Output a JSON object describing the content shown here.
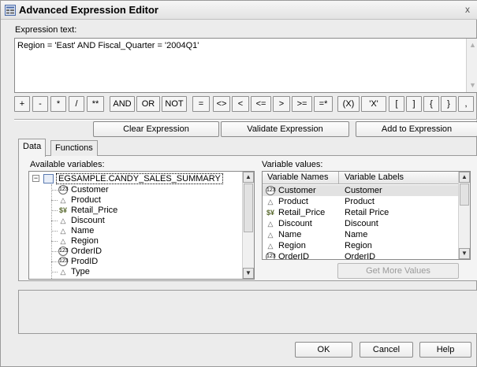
{
  "window": {
    "title": "Advanced Expression Editor",
    "close_glyph": "x"
  },
  "expression": {
    "label": "Expression text:",
    "value": "Region = 'East' AND Fiscal_Quarter = '2004Q1'"
  },
  "operators": [
    "+",
    "-",
    "*",
    "/",
    "**",
    "AND",
    "OR",
    "NOT",
    "=",
    "<>",
    "<",
    "<=",
    ">",
    ">=",
    "=*",
    "(X)",
    "'X'",
    "[",
    "]",
    "{",
    "}",
    ","
  ],
  "actions": {
    "clear": "Clear Expression",
    "validate": "Validate Expression",
    "add": "Add to Expression"
  },
  "tabs": [
    "Data",
    "Functions"
  ],
  "available": {
    "label": "Available variables:",
    "root": "EGSAMPLE.CANDY_SALES_SUMMARY",
    "expander": "−",
    "items": [
      {
        "name": "Customer",
        "icon": "numeric-icon"
      },
      {
        "name": "Product",
        "icon": "character-icon"
      },
      {
        "name": "Retail_Price",
        "icon": "currency-icon"
      },
      {
        "name": "Discount",
        "icon": "character-icon"
      },
      {
        "name": "Name",
        "icon": "character-icon"
      },
      {
        "name": "Region",
        "icon": "character-icon"
      },
      {
        "name": "OrderID",
        "icon": "numeric-icon"
      },
      {
        "name": "ProdID",
        "icon": "numeric-icon"
      },
      {
        "name": "Type",
        "icon": "character-icon"
      }
    ]
  },
  "values": {
    "label": "Variable values:",
    "col_names": "Variable Names",
    "col_labels": "Variable Labels",
    "rows": [
      {
        "name": "Customer",
        "label": "Customer",
        "icon": "numeric-icon"
      },
      {
        "name": "Product",
        "label": "Product",
        "icon": "character-icon"
      },
      {
        "name": "Retail_Price",
        "label": "Retail Price",
        "icon": "currency-icon"
      },
      {
        "name": "Discount",
        "label": "Discount",
        "icon": "character-icon"
      },
      {
        "name": "Name",
        "label": "Name",
        "icon": "character-icon"
      },
      {
        "name": "Region",
        "label": "Region",
        "icon": "character-icon"
      },
      {
        "name": "OrderID",
        "label": "OrderID",
        "icon": "numeric-icon"
      }
    ],
    "get_more": "Get More Values"
  },
  "footer": {
    "ok": "OK",
    "cancel": "Cancel",
    "help": "Help"
  }
}
